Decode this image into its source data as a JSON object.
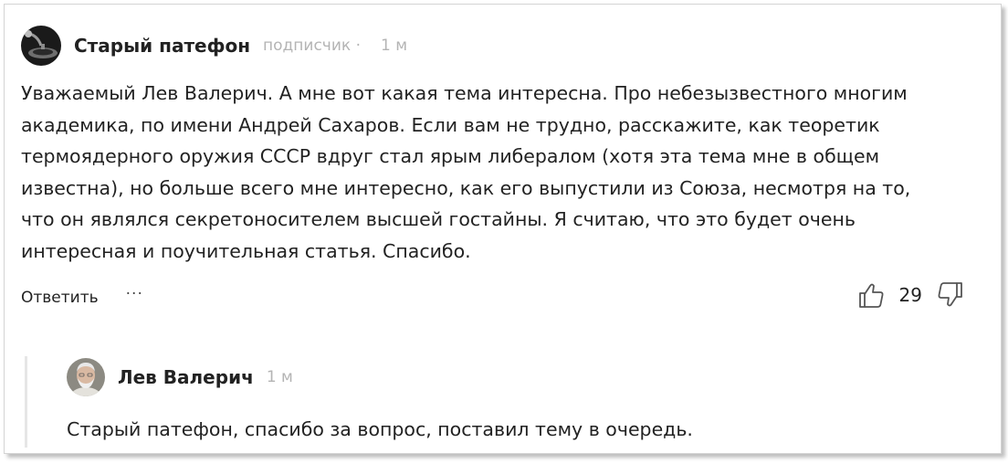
{
  "comment": {
    "author": "Старый патефон",
    "badge": "подписчик ·",
    "time": "1 м",
    "text": "Уважаемый Лев Валерич. А мне вот какая тема интересна. Про небезызвестного многим академика, по имени Андрей Сахаров. Если вам не трудно, расскажите, как теоретик термоядерного оружия СССР вдруг стал ярым либералом (хотя эта тема мне в общем известна), но больше всего мне интересно, как его выпустили из Союза, несмотря на то, что он являлся секретоносителем высшей гостайны. Я считаю, что это будет очень интересная и поучительная статья. Спасибо.",
    "reply_label": "Ответить",
    "more_label": "···",
    "likes": "29",
    "like_icon": "thumbs-up-icon",
    "dislike_icon": "thumbs-down-icon"
  },
  "reply": {
    "author": "Лев Валерич",
    "time": "1 м",
    "text": "Старый патефон, спасибо за вопрос, поставил тему в очередь."
  },
  "colors": {
    "text": "#222222",
    "muted": "#b4b4b4",
    "thread_line": "#e6e6e6",
    "icon": "#555555"
  }
}
